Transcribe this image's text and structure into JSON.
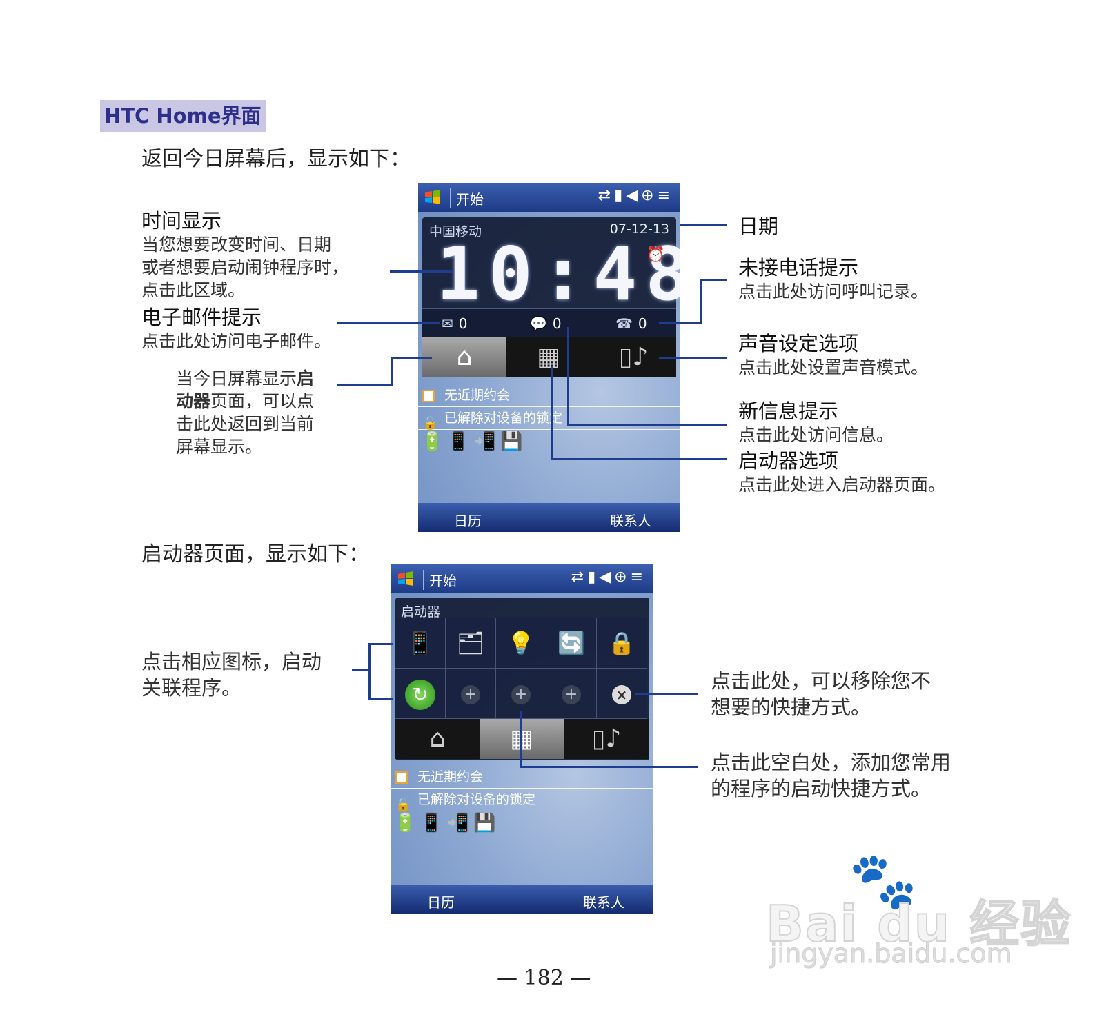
{
  "section_title": "HTC Home界面",
  "intro_home": "返回今日屏幕后，显示如下：",
  "intro_launcher": "启动器页面，显示如下：",
  "annotations": {
    "time": {
      "title": "时间显示",
      "body": [
        "当您想要改变时间、日期",
        "或者想要启动闹钟程序时，",
        "点击此区域。"
      ]
    },
    "email": {
      "title": "电子邮件提示",
      "body": "点击此处访问电子邮件。"
    },
    "home_return": {
      "b1": "当今日屏幕显示",
      "b2": "启",
      "b3": "动器",
      "b4": "页面，可以点",
      "l2": "击此处返回到当前",
      "l3": "屏幕显示。"
    },
    "date": {
      "title": "日期"
    },
    "missed": {
      "title": "未接电话提示",
      "body": "点击此处访问呼叫记录。"
    },
    "sound": {
      "title": "声音设定选项",
      "body": "点击此处设置声音模式。"
    },
    "message": {
      "title": "新信息提示",
      "body": "点击此处访问信息。"
    },
    "launcher": {
      "title": "启动器选项",
      "body": "点击此处进入启动器页面。"
    },
    "tap_icon": [
      "点击相应图标，启动",
      "关联程序。"
    ],
    "remove": [
      "点击此处，可以移除您不",
      "想要的快捷方式。"
    ],
    "add": [
      "点击此空白处，添加您常用",
      "的程序的启动快捷方式。"
    ]
  },
  "phone": {
    "start_label": "开始",
    "carrier": "中国移动",
    "date": "07-12-13",
    "time": "10:48",
    "email_count": "0",
    "sms_count": "0",
    "missed_count": "0",
    "appointments": "无近期约会",
    "lock_status": "已解除对设备的锁定",
    "soft_left": "日历",
    "soft_right": "联系人",
    "launcher_title": "启动器"
  },
  "icons": {
    "windows_logo": "windows-flag",
    "status": [
      "sync-arrows",
      "signal",
      "volume",
      "connectivity",
      "menu"
    ],
    "email": "envelope",
    "sms": "message-bubble",
    "missed_call": "phone-missed",
    "tabs": [
      "home",
      "launcher-grid",
      "phone-sound"
    ]
  },
  "watermark": {
    "brand": "Bai du 经验",
    "url": "jingyan.baidu.com"
  },
  "page_number": "— 182 —",
  "colors": {
    "accent": "#2e2f8c",
    "tag_bg": "#c9c7e4",
    "line": "#1f3d8f"
  }
}
